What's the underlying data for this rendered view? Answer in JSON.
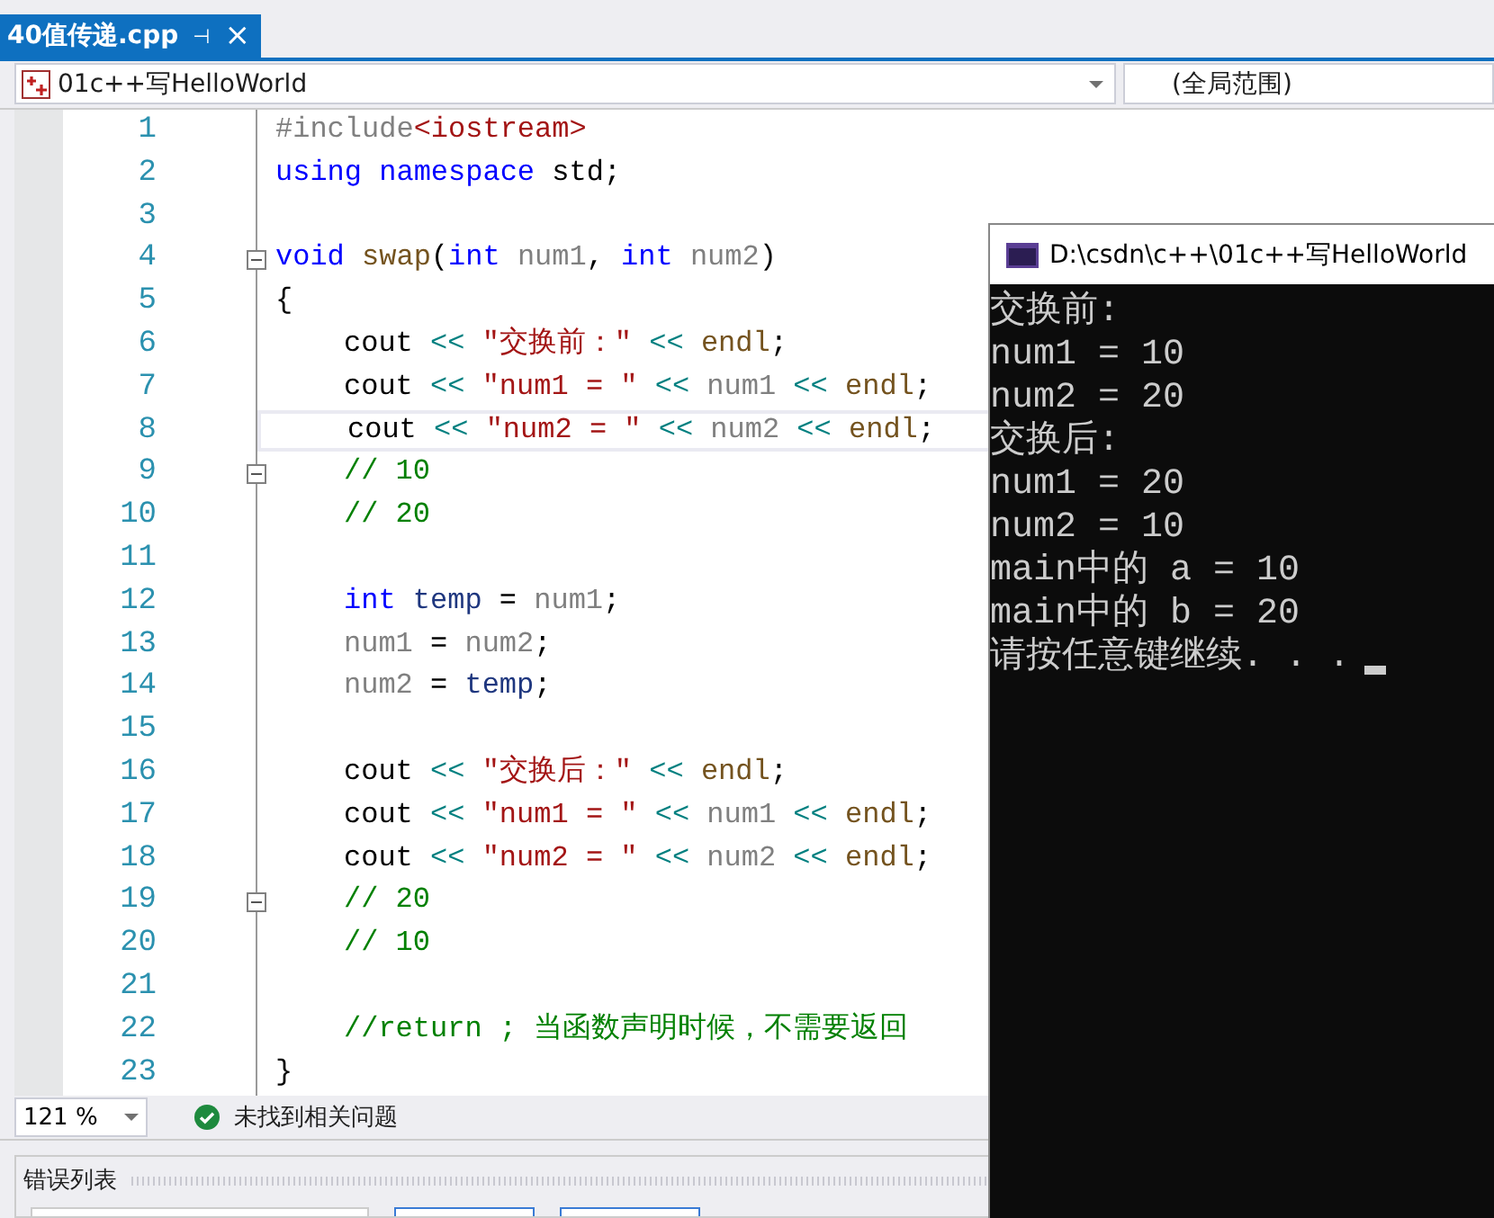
{
  "tab": {
    "title": "40值传递.cpp",
    "pin": "⊣",
    "close": "×",
    "selected": true
  },
  "nav": {
    "project": "01c++写HelloWorld",
    "scope": "(全局范围)"
  },
  "editor": {
    "lines": [
      {
        "number": "1",
        "tokens": [
          {
            "kind": "pre",
            "text": "#include"
          },
          {
            "kind": "inc",
            "text": "<iostream>"
          }
        ]
      },
      {
        "number": "2",
        "tokens": [
          {
            "kind": "kw",
            "text": "using "
          },
          {
            "kind": "kw",
            "text": "namespace "
          },
          {
            "kind": "plain",
            "text": "std;"
          }
        ]
      },
      {
        "number": "3"
      },
      {
        "number": "4",
        "fold": true,
        "tokens": [
          {
            "kind": "kw",
            "text": "void "
          },
          {
            "kind": "fn",
            "text": "swap"
          },
          {
            "kind": "plain",
            "text": "("
          },
          {
            "kind": "kw",
            "text": "int "
          },
          {
            "kind": "param",
            "text": "num1"
          },
          {
            "kind": "plain",
            "text": ", "
          },
          {
            "kind": "kw",
            "text": "int "
          },
          {
            "kind": "param",
            "text": "num2"
          },
          {
            "kind": "plain",
            "text": ")"
          }
        ]
      },
      {
        "number": "5",
        "tokens": [
          {
            "kind": "plain",
            "text": "{"
          }
        ]
      },
      {
        "number": "6",
        "indent": true,
        "tokens": [
          {
            "kind": "plain",
            "text": "cout "
          },
          {
            "kind": "op",
            "text": "<< "
          },
          {
            "kind": "str",
            "text": "\"交换前：\" "
          },
          {
            "kind": "op",
            "text": "<< "
          },
          {
            "kind": "fn",
            "text": "endl"
          },
          {
            "kind": "plain",
            "text": ";"
          }
        ]
      },
      {
        "number": "7",
        "indent": true,
        "tokens": [
          {
            "kind": "plain",
            "text": "cout "
          },
          {
            "kind": "op",
            "text": "<< "
          },
          {
            "kind": "str",
            "text": "\"num1 = \" "
          },
          {
            "kind": "op",
            "text": "<< "
          },
          {
            "kind": "param",
            "text": "num1 "
          },
          {
            "kind": "op",
            "text": "<< "
          },
          {
            "kind": "fn",
            "text": "endl"
          },
          {
            "kind": "plain",
            "text": ";"
          }
        ]
      },
      {
        "number": "8",
        "indent": true,
        "current": true,
        "tokens": [
          {
            "kind": "plain",
            "text": "cout "
          },
          {
            "kind": "op",
            "text": "<< "
          },
          {
            "kind": "str",
            "text": "\"num2 = \" "
          },
          {
            "kind": "op",
            "text": "<< "
          },
          {
            "kind": "param",
            "text": "num2 "
          },
          {
            "kind": "op",
            "text": "<< "
          },
          {
            "kind": "fn",
            "text": "endl"
          },
          {
            "kind": "plain",
            "text": ";"
          }
        ]
      },
      {
        "number": "9",
        "indent": true,
        "fold": true,
        "tokens": [
          {
            "kind": "comment",
            "text": "// 10"
          }
        ]
      },
      {
        "number": "10",
        "indent": true,
        "tokens": [
          {
            "kind": "comment",
            "text": "// 20"
          }
        ]
      },
      {
        "number": "11"
      },
      {
        "number": "12",
        "indent": true,
        "tokens": [
          {
            "kind": "kw",
            "text": "int "
          },
          {
            "kind": "local",
            "text": "temp "
          },
          {
            "kind": "plain",
            "text": "= "
          },
          {
            "kind": "param",
            "text": "num1"
          },
          {
            "kind": "plain",
            "text": ";"
          }
        ]
      },
      {
        "number": "13",
        "indent": true,
        "tokens": [
          {
            "kind": "param",
            "text": "num1 "
          },
          {
            "kind": "plain",
            "text": "= "
          },
          {
            "kind": "param",
            "text": "num2"
          },
          {
            "kind": "plain",
            "text": ";"
          }
        ]
      },
      {
        "number": "14",
        "indent": true,
        "tokens": [
          {
            "kind": "param",
            "text": "num2 "
          },
          {
            "kind": "plain",
            "text": "= "
          },
          {
            "kind": "local",
            "text": "temp"
          },
          {
            "kind": "plain",
            "text": ";"
          }
        ]
      },
      {
        "number": "15"
      },
      {
        "number": "16",
        "indent": true,
        "tokens": [
          {
            "kind": "plain",
            "text": "cout "
          },
          {
            "kind": "op",
            "text": "<< "
          },
          {
            "kind": "str",
            "text": "\"交换后：\" "
          },
          {
            "kind": "op",
            "text": "<< "
          },
          {
            "kind": "fn",
            "text": "endl"
          },
          {
            "kind": "plain",
            "text": ";"
          }
        ]
      },
      {
        "number": "17",
        "indent": true,
        "tokens": [
          {
            "kind": "plain",
            "text": "cout "
          },
          {
            "kind": "op",
            "text": "<< "
          },
          {
            "kind": "str",
            "text": "\"num1 = \" "
          },
          {
            "kind": "op",
            "text": "<< "
          },
          {
            "kind": "param",
            "text": "num1 "
          },
          {
            "kind": "op",
            "text": "<< "
          },
          {
            "kind": "fn",
            "text": "endl"
          },
          {
            "kind": "plain",
            "text": ";"
          }
        ]
      },
      {
        "number": "18",
        "indent": true,
        "tokens": [
          {
            "kind": "plain",
            "text": "cout "
          },
          {
            "kind": "op",
            "text": "<< "
          },
          {
            "kind": "str",
            "text": "\"num2 = \" "
          },
          {
            "kind": "op",
            "text": "<< "
          },
          {
            "kind": "param",
            "text": "num2 "
          },
          {
            "kind": "op",
            "text": "<< "
          },
          {
            "kind": "fn",
            "text": "endl"
          },
          {
            "kind": "plain",
            "text": ";"
          }
        ]
      },
      {
        "number": "19",
        "indent": true,
        "fold": true,
        "tokens": [
          {
            "kind": "comment",
            "text": "// 20"
          }
        ]
      },
      {
        "number": "20",
        "indent": true,
        "tokens": [
          {
            "kind": "comment",
            "text": "// 10"
          }
        ]
      },
      {
        "number": "21"
      },
      {
        "number": "22",
        "indent": true,
        "tokens": [
          {
            "kind": "comment",
            "text": "//return ; 当函数声明时候，不需要返回"
          }
        ]
      },
      {
        "number": "23",
        "tokens": [
          {
            "kind": "plain",
            "text": "}"
          }
        ]
      }
    ]
  },
  "status_bar": {
    "zoom": "121 %",
    "message": "未找到相关问题"
  },
  "error_list": {
    "title": "错误列表"
  },
  "console": {
    "title": "D:\\csdn\\c++\\01c++写HelloWorld",
    "lines": [
      "交换前:",
      "num1 = 10",
      "num2 = 20",
      "交换后:",
      "num1 = 20",
      "num2 = 10",
      "main中的 a = 10",
      "main中的 b = 20",
      "请按任意键继续. . ."
    ]
  }
}
